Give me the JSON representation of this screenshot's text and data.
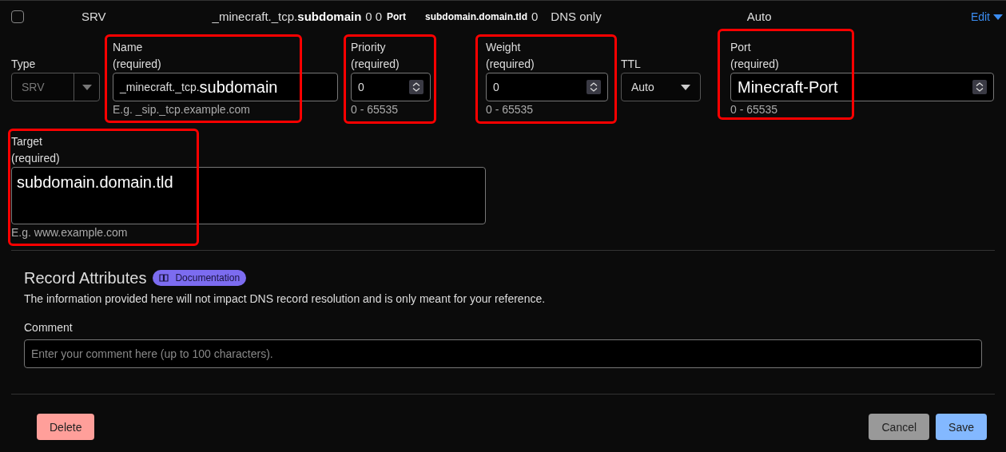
{
  "summary": {
    "checked": false,
    "type": "SRV",
    "name_prefix": "_minecraft._tcp.",
    "name_highlight": "subdomain",
    "priority": "0",
    "weight": "0",
    "port": "Port",
    "target": "subdomain.domain.tld",
    "port_number": "0",
    "proxy": "DNS only",
    "ttl": "Auto",
    "edit": "Edit"
  },
  "fields": [
    {
      "kind": "select",
      "label": "Type",
      "value": "SRV",
      "disabled": true
    },
    {
      "kind": "name",
      "label": "Name",
      "required": "(required)",
      "prefix": "_minecraft._tcp.",
      "value": "subdomain",
      "hint": "E.g. _sip._tcp.example.com",
      "highlighted": true
    },
    {
      "kind": "number",
      "label": "Priority",
      "required": "(required)",
      "value": "0",
      "hint": "0 - 65535",
      "highlighted": true
    },
    {
      "kind": "number",
      "label": "Weight",
      "required": "(required)",
      "value": "0",
      "hint": "0 - 65535",
      "highlighted": true
    },
    {
      "kind": "select",
      "label": "TTL",
      "value": "Auto",
      "disabled": false
    },
    {
      "kind": "number",
      "label": "Port",
      "required": "(required)",
      "value": "Minecraft-Port",
      "hint": "0 - 65535",
      "large": true,
      "highlighted": true
    }
  ],
  "target": {
    "label": "Target",
    "required": "(required)",
    "value": "subdomain.domain.tld",
    "hint": "E.g. www.example.com",
    "highlighted": true
  },
  "attributes": {
    "title": "Record Attributes",
    "badge": "Documentation",
    "description": "The information provided here will not impact DNS record resolution and is only meant for your reference.",
    "comment_label": "Comment",
    "comment_placeholder": "Enter your comment here (up to 100 characters)."
  },
  "buttons": {
    "delete": "Delete",
    "cancel": "Cancel",
    "save": "Save"
  }
}
